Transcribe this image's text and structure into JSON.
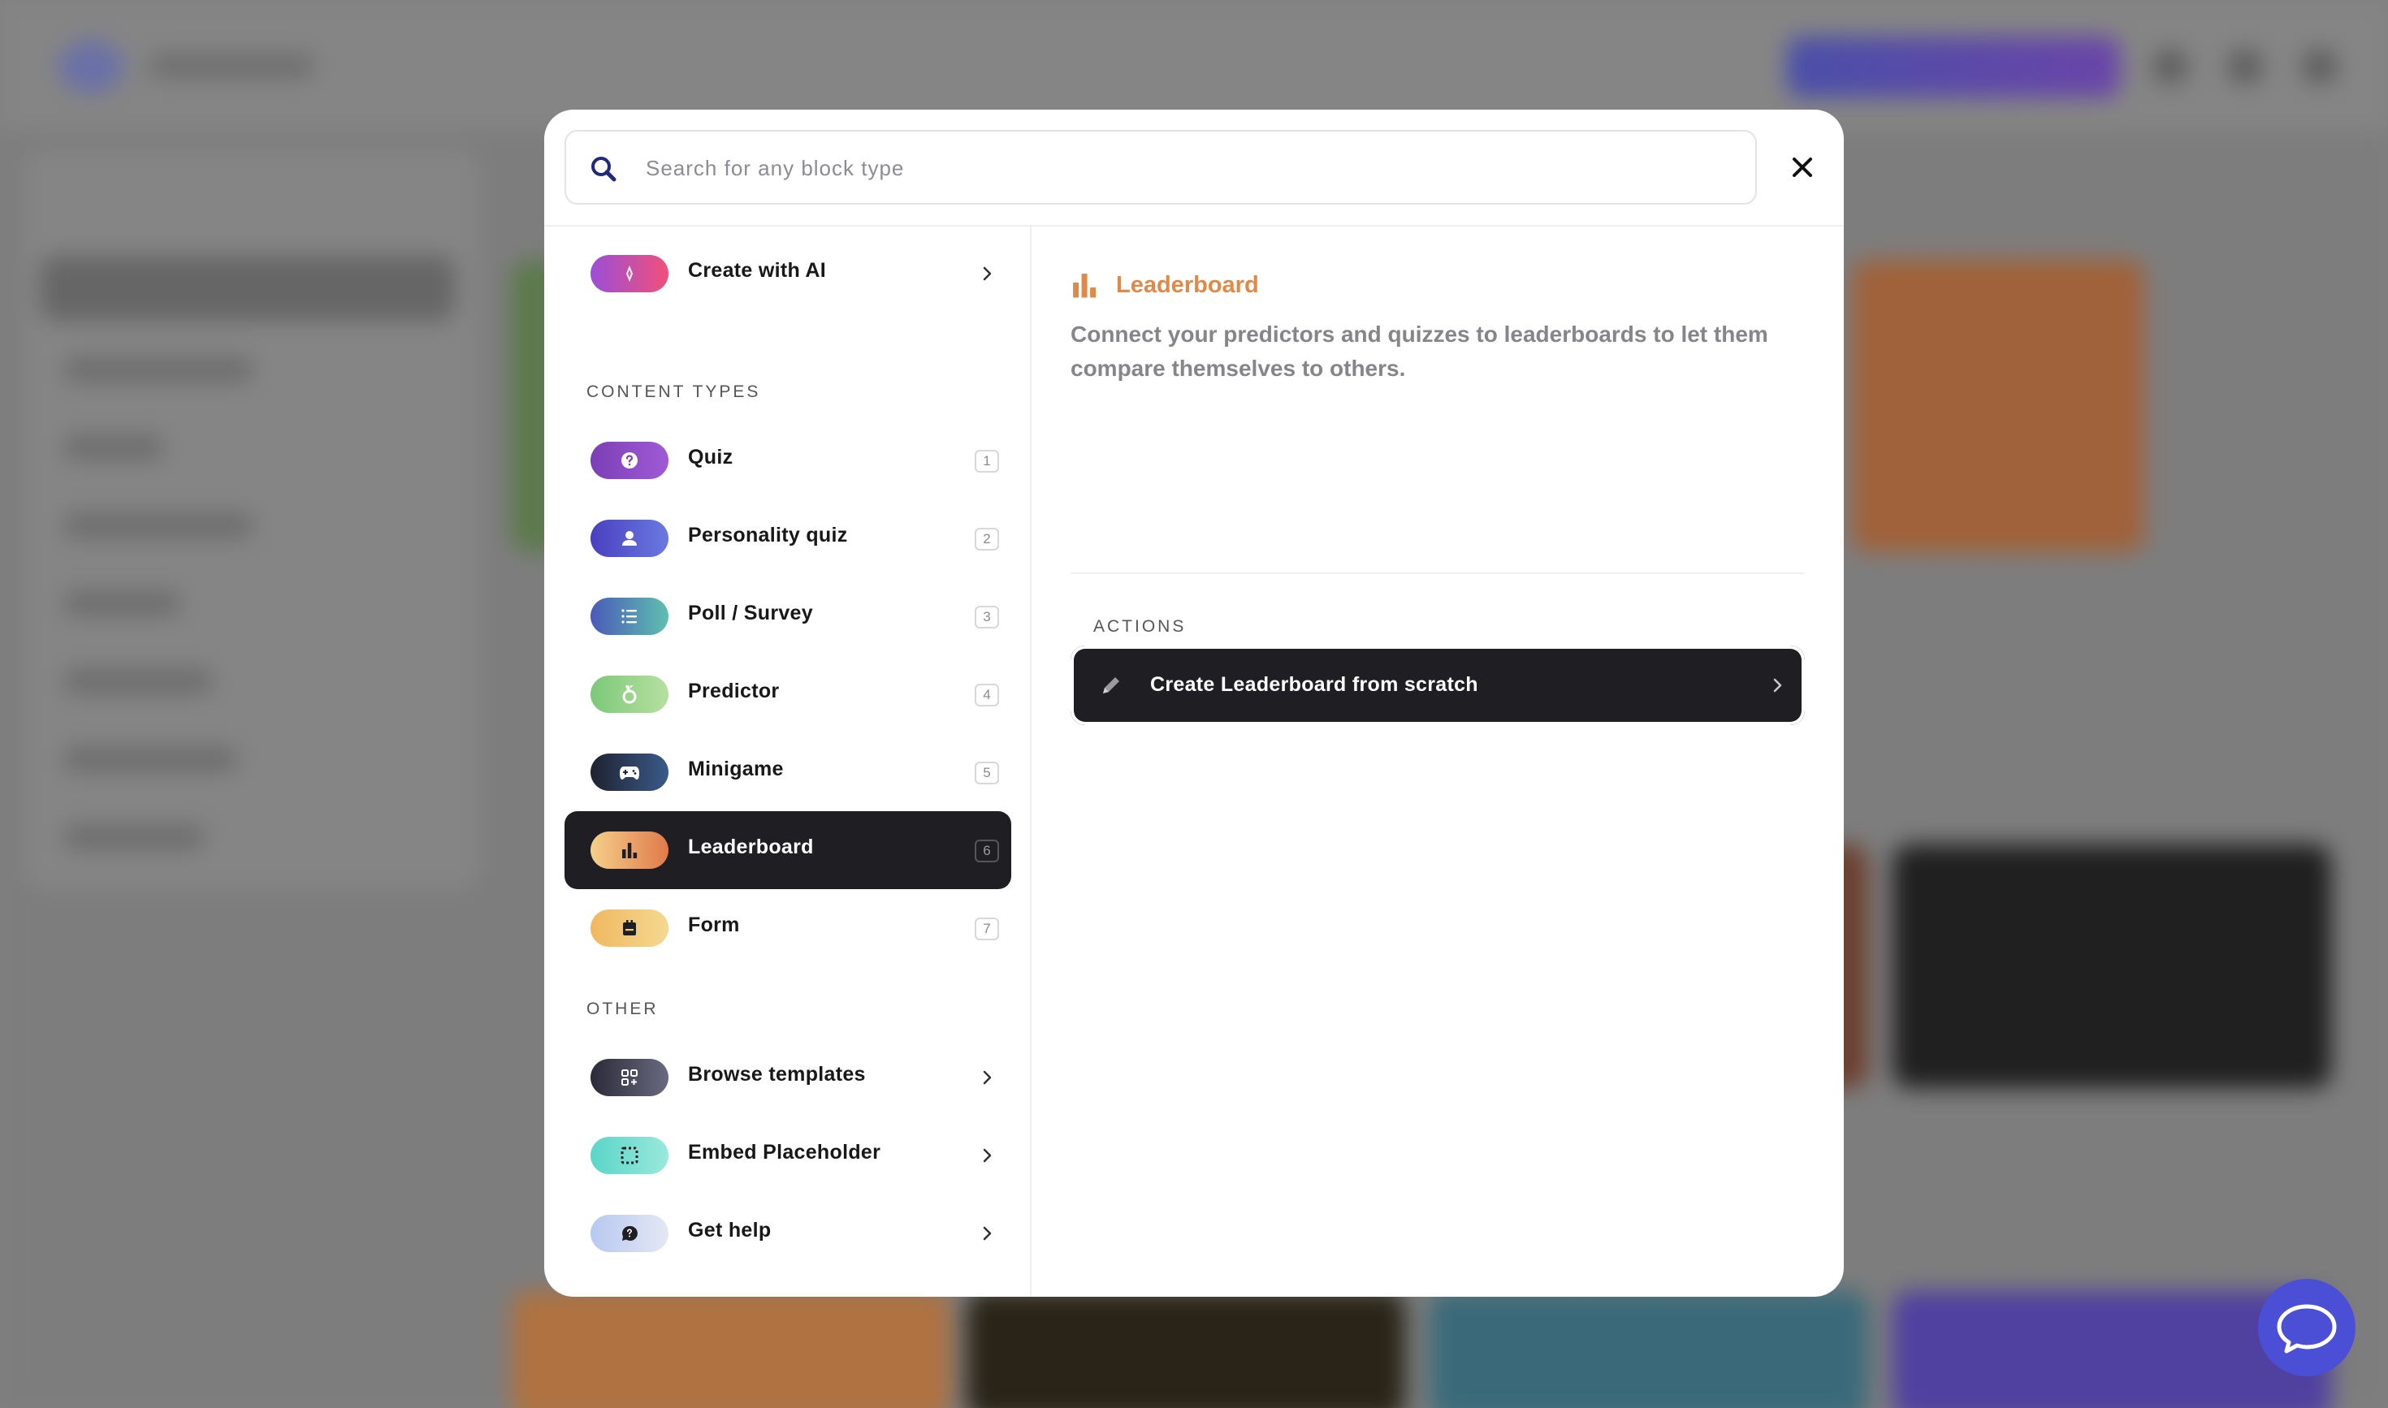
{
  "search": {
    "placeholder": "Search for any block type",
    "value": ""
  },
  "ai_item": {
    "label": "Create with AI",
    "icon": "sparkle-icon"
  },
  "content_types": {
    "section_label": "CONTENT TYPES",
    "items": [
      {
        "label": "Quiz",
        "shortcut": "1",
        "icon": "question-icon"
      },
      {
        "label": "Personality quiz",
        "shortcut": "2",
        "icon": "person-icon"
      },
      {
        "label": "Poll / Survey",
        "shortcut": "3",
        "icon": "list-icon"
      },
      {
        "label": "Predictor",
        "shortcut": "4",
        "icon": "medal-icon"
      },
      {
        "label": "Minigame",
        "shortcut": "5",
        "icon": "gamepad-icon"
      },
      {
        "label": "Leaderboard",
        "shortcut": "6",
        "icon": "bar-chart-icon"
      },
      {
        "label": "Form",
        "shortcut": "7",
        "icon": "form-icon"
      }
    ],
    "selected": "Leaderboard"
  },
  "other": {
    "section_label": "OTHER",
    "items": [
      {
        "label": "Browse templates",
        "icon": "templates-icon"
      },
      {
        "label": "Embed Placeholder",
        "icon": "embed-icon"
      },
      {
        "label": "Get help",
        "icon": "help-chat-icon"
      }
    ]
  },
  "detail": {
    "title": "Leaderboard",
    "description": "Connect your predictors and quizzes to leaderboards to let them compare themselves to others.",
    "actions_label": "ACTIONS",
    "actions": [
      {
        "label": "Create Leaderboard from scratch",
        "icon": "pencil-icon"
      }
    ]
  },
  "colors": {
    "accent": "#e08a4a",
    "selected_bg": "#1f1f23",
    "chat_button": "#4b4fd6"
  }
}
